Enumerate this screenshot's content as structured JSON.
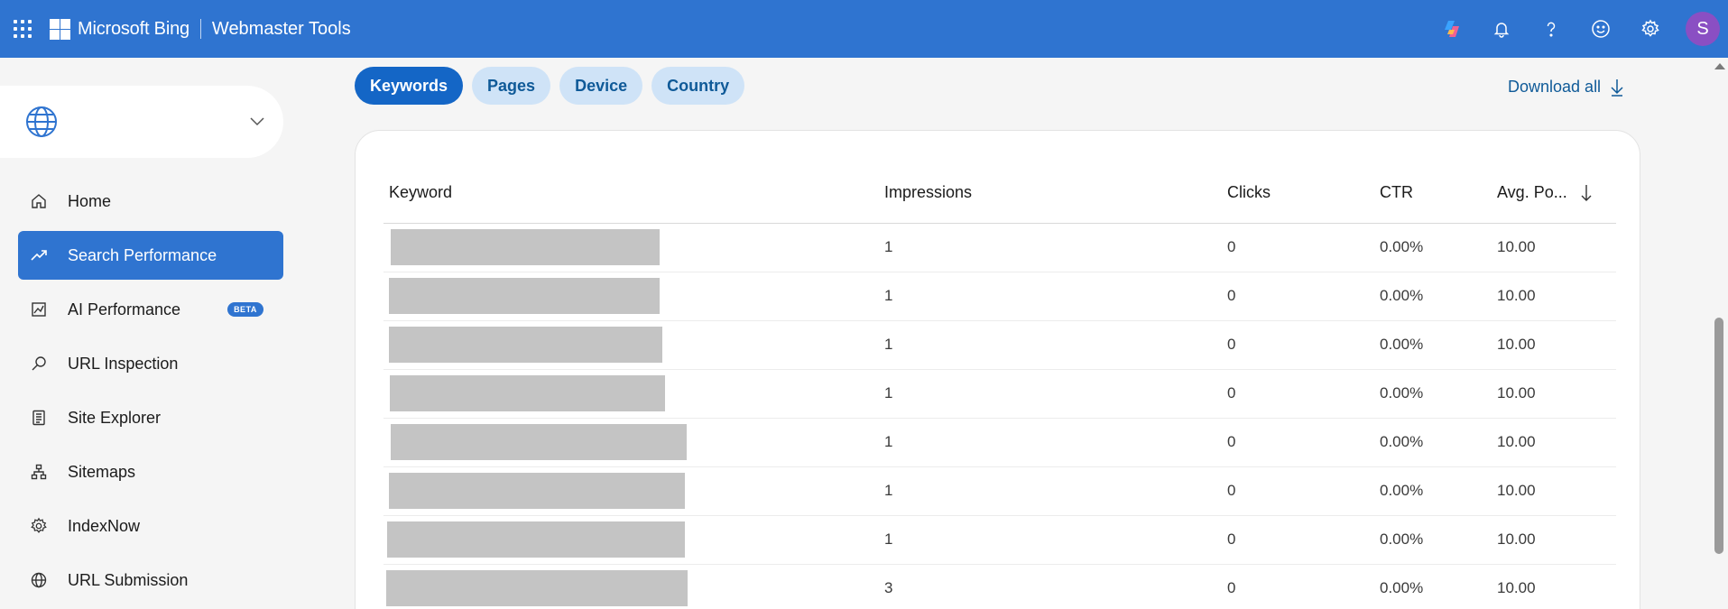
{
  "header": {
    "brand": "Microsoft Bing",
    "product": "Webmaster Tools",
    "avatar_initial": "S",
    "icons": [
      "apps-waffle-icon",
      "copilot-icon",
      "bell-icon",
      "help-icon",
      "smiley-feedback-icon",
      "gear-icon"
    ]
  },
  "sidebar": {
    "site_picker_icon": "globe-icon",
    "items": [
      {
        "label": "Home",
        "icon": "home-icon"
      },
      {
        "label": "Search Performance",
        "icon": "trend-icon",
        "active": true
      },
      {
        "label": "AI Performance",
        "icon": "chart-icon",
        "badge": "BETA"
      },
      {
        "label": "URL Inspection",
        "icon": "search-icon"
      },
      {
        "label": "Site Explorer",
        "icon": "document-icon"
      },
      {
        "label": "Sitemaps",
        "icon": "sitemap-icon"
      },
      {
        "label": "IndexNow",
        "icon": "gear-icon"
      },
      {
        "label": "URL Submission",
        "icon": "globe-icon"
      }
    ]
  },
  "tabs": [
    {
      "label": "Keywords",
      "active": true
    },
    {
      "label": "Pages"
    },
    {
      "label": "Device"
    },
    {
      "label": "Country"
    }
  ],
  "download_label": "Download all",
  "table": {
    "columns": [
      "Keyword",
      "Impressions",
      "Clicks",
      "CTR",
      "Avg. Po..."
    ],
    "rows": [
      {
        "impressions": "1",
        "clicks": "0",
        "ctr": "0.00%",
        "avg_position": "10.00"
      },
      {
        "impressions": "1",
        "clicks": "0",
        "ctr": "0.00%",
        "avg_position": "10.00"
      },
      {
        "impressions": "1",
        "clicks": "0",
        "ctr": "0.00%",
        "avg_position": "10.00"
      },
      {
        "impressions": "1",
        "clicks": "0",
        "ctr": "0.00%",
        "avg_position": "10.00"
      },
      {
        "impressions": "1",
        "clicks": "0",
        "ctr": "0.00%",
        "avg_position": "10.00"
      },
      {
        "impressions": "1",
        "clicks": "0",
        "ctr": "0.00%",
        "avg_position": "10.00"
      },
      {
        "impressions": "1",
        "clicks": "0",
        "ctr": "0.00%",
        "avg_position": "10.00"
      },
      {
        "impressions": "3",
        "clicks": "0",
        "ctr": "0.00%",
        "avg_position": "10.00"
      }
    ]
  },
  "colors": {
    "accent": "#2f74d0",
    "tab_active": "#1466c6",
    "tab_inactive_bg": "#cfe3f7",
    "link": "#0f5a98",
    "avatar": "#8a4fc3"
  }
}
